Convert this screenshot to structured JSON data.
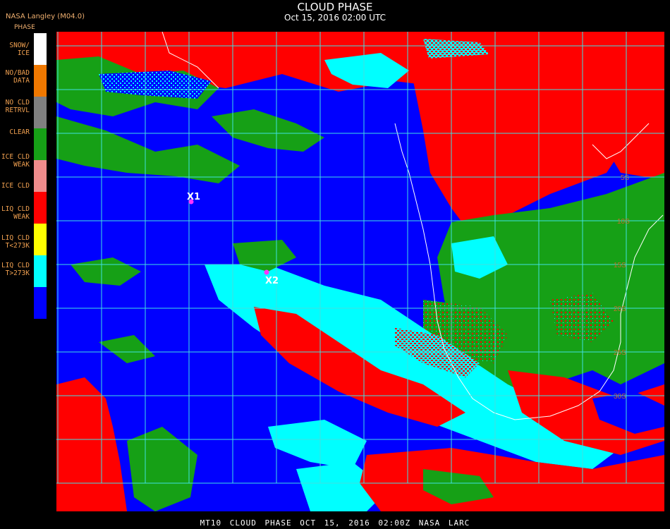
{
  "header": {
    "title": "CLOUD PHASE",
    "subtitle": "Oct 15, 2016 02:00 UTC",
    "source": "NASA Langley (M04.0)"
  },
  "legend": {
    "title": "PHASE",
    "items": [
      {
        "label": "SNOW/\nICE",
        "color": "#ffffff"
      },
      {
        "label": "NO/BAD\nDATA",
        "color": "#f07800"
      },
      {
        "label": "NO CLD\nRETRVL",
        "color": "#808080"
      },
      {
        "label": "CLEAR",
        "color": "#16a016"
      },
      {
        "label": "ICE CLD\nWEAK",
        "color": "#f08c8c"
      },
      {
        "label": "ICE CLD",
        "color": "#ff0000"
      },
      {
        "label": "LIQ CLD\nWEAK",
        "color": "#ffff00"
      },
      {
        "label": "LIQ CLD\nT<273K",
        "color": "#00ffff"
      },
      {
        "label": "LIQ CLD\nT>273K",
        "color": "#0000ff"
      }
    ]
  },
  "map": {
    "markers": [
      {
        "label": "X1",
        "color": "#ff33ff"
      },
      {
        "label": "X2",
        "color": "#ff33ff"
      }
    ],
    "lat_labels": [
      "5S",
      "10S",
      "15S",
      "20S",
      "25S",
      "30S"
    ],
    "grid_color": "#40e0e0"
  },
  "footer": {
    "text": "MT10  CLOUD PHASE   OCT 15, 2016 02:00Z   NASA LARC"
  }
}
